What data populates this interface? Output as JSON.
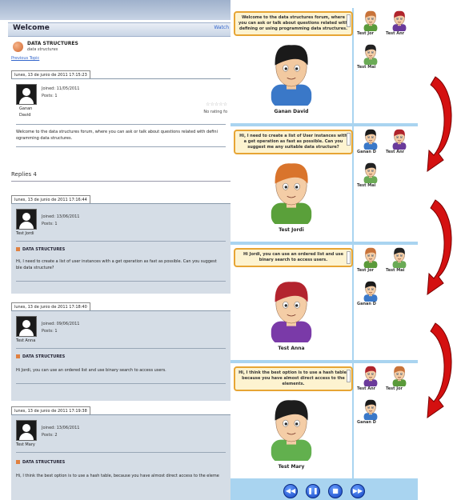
{
  "forum": {
    "section_title": "Welcome",
    "watch_label": "Watch",
    "forum_name": "DATA STRUCTURES",
    "forum_sub": "data structures",
    "previous_topic": "Previous Topic",
    "first_post": {
      "date": "lunes, 13 de junio de 2011 17:15:23",
      "joined": "Joined: 11/05/2011",
      "posts": "Posts: 1",
      "user_line1": "Ganan",
      "user_line2": "David",
      "stars": "☆☆☆☆☆",
      "rating": "No rating fo",
      "text_line1": "Welcome to the data structures forum, where you can ask or talk about questions related with defini",
      "text_line2": "ogramming data structures."
    },
    "replies_label": "Replies 4",
    "replies": [
      {
        "date": "lunes, 13 de junio de 2011 17:16:44",
        "joined": "Joined: 13/06/2011",
        "posts": "Posts: 1",
        "user": "Test Jordi",
        "title": "DATA STRUCTURES",
        "text_line1": "Hi, I need to create a list of user instances with a get operation as fast as possible. Can you suggest",
        "text_line2": "ble data structure?"
      },
      {
        "date": "lunes, 13 de junio de 2011 17:18:40",
        "joined": "Joined: 09/06/2011",
        "posts": "Posts: 1",
        "user": "Test Anna",
        "title": "DATA STRUCTURES",
        "text_line1": "Hi Jordi, you can use an ordered list and use binary search to access users.",
        "text_line2": ""
      },
      {
        "date": "lunes, 13 de junio de 2011 17:19:38",
        "joined": "Joined: 13/06/2011",
        "posts": "Posts: 2",
        "user": "Test Mary",
        "title": "DATA STRUCTURES",
        "text_line1": "Hi, I think the best option is to use a hash table, because you have almost direct access to the eleme",
        "text_line2": ""
      }
    ]
  },
  "chat": {
    "scenes": [
      {
        "speech": "Welcome to the data structures forum, where you can ask or talk about questions related with defining or using programming data structures.",
        "speaker": "Ganan David",
        "hair": "#1a1a1a",
        "shirt": "#3a78c8",
        "skin": "#f2c9a0",
        "watchers": [
          {
            "name": "Test Jor",
            "hair": "#c8733a",
            "shirt": "#5a9a3a"
          },
          {
            "name": "Test Anr",
            "hair": "#b0242c",
            "shirt": "#6a3a9a"
          },
          {
            "name": "Test Mai",
            "hair": "#222222",
            "shirt": "#6aaa55"
          }
        ]
      },
      {
        "speech": "Hi, I need to create a list of User instances with a get operation as fast as possible. Can you suggest me any suitable data structure?",
        "speaker": "Test Jordi",
        "hair": "#d9742c",
        "shirt": "#5aa03a",
        "skin": "#f4cda6",
        "watchers": [
          {
            "name": "Ganan D",
            "hair": "#1a1a1a",
            "shirt": "#3a78c8"
          },
          {
            "name": "Test Anr",
            "hair": "#b0242c",
            "shirt": "#6a3a9a"
          },
          {
            "name": "Test Mai",
            "hair": "#222222",
            "shirt": "#6aaa55"
          }
        ]
      },
      {
        "speech": "Hi Jordi, you can use an ordered list and use binary search to access users.",
        "speaker": "Test Anna",
        "hair": "#b3242e",
        "shirt": "#7a3aa8",
        "skin": "#f4cda6",
        "watchers": [
          {
            "name": "Test Jor",
            "hair": "#c8733a",
            "shirt": "#5a9a3a"
          },
          {
            "name": "Test Mai",
            "hair": "#222222",
            "shirt": "#6aaa55"
          },
          {
            "name": "Ganan D",
            "hair": "#1a1a1a",
            "shirt": "#3a78c8"
          }
        ]
      },
      {
        "speech": "Hi, I think the best option is to use a hash table, because you have almost direct access to the elements.",
        "speaker": "Test Mary",
        "hair": "#1c1c1c",
        "shirt": "#62b04e",
        "skin": "#f4cda6",
        "watchers": [
          {
            "name": "Test Anr",
            "hair": "#b0242c",
            "shirt": "#6a3a9a"
          },
          {
            "name": "Test Jor",
            "hair": "#c8733a",
            "shirt": "#5a9a3a"
          },
          {
            "name": "Ganan D",
            "hair": "#1a1a1a",
            "shirt": "#3a78c8"
          }
        ]
      }
    ],
    "controls": [
      "rewind-icon",
      "pause-icon",
      "stop-icon",
      "fast-forward-icon"
    ],
    "control_glyphs": [
      "◀◀",
      "❚❚",
      "■",
      "▶▶"
    ]
  },
  "colors": {
    "panel_bg": "#a9d4f0",
    "bubble_border": "#e7a534",
    "arrow_red": "#d41010"
  }
}
